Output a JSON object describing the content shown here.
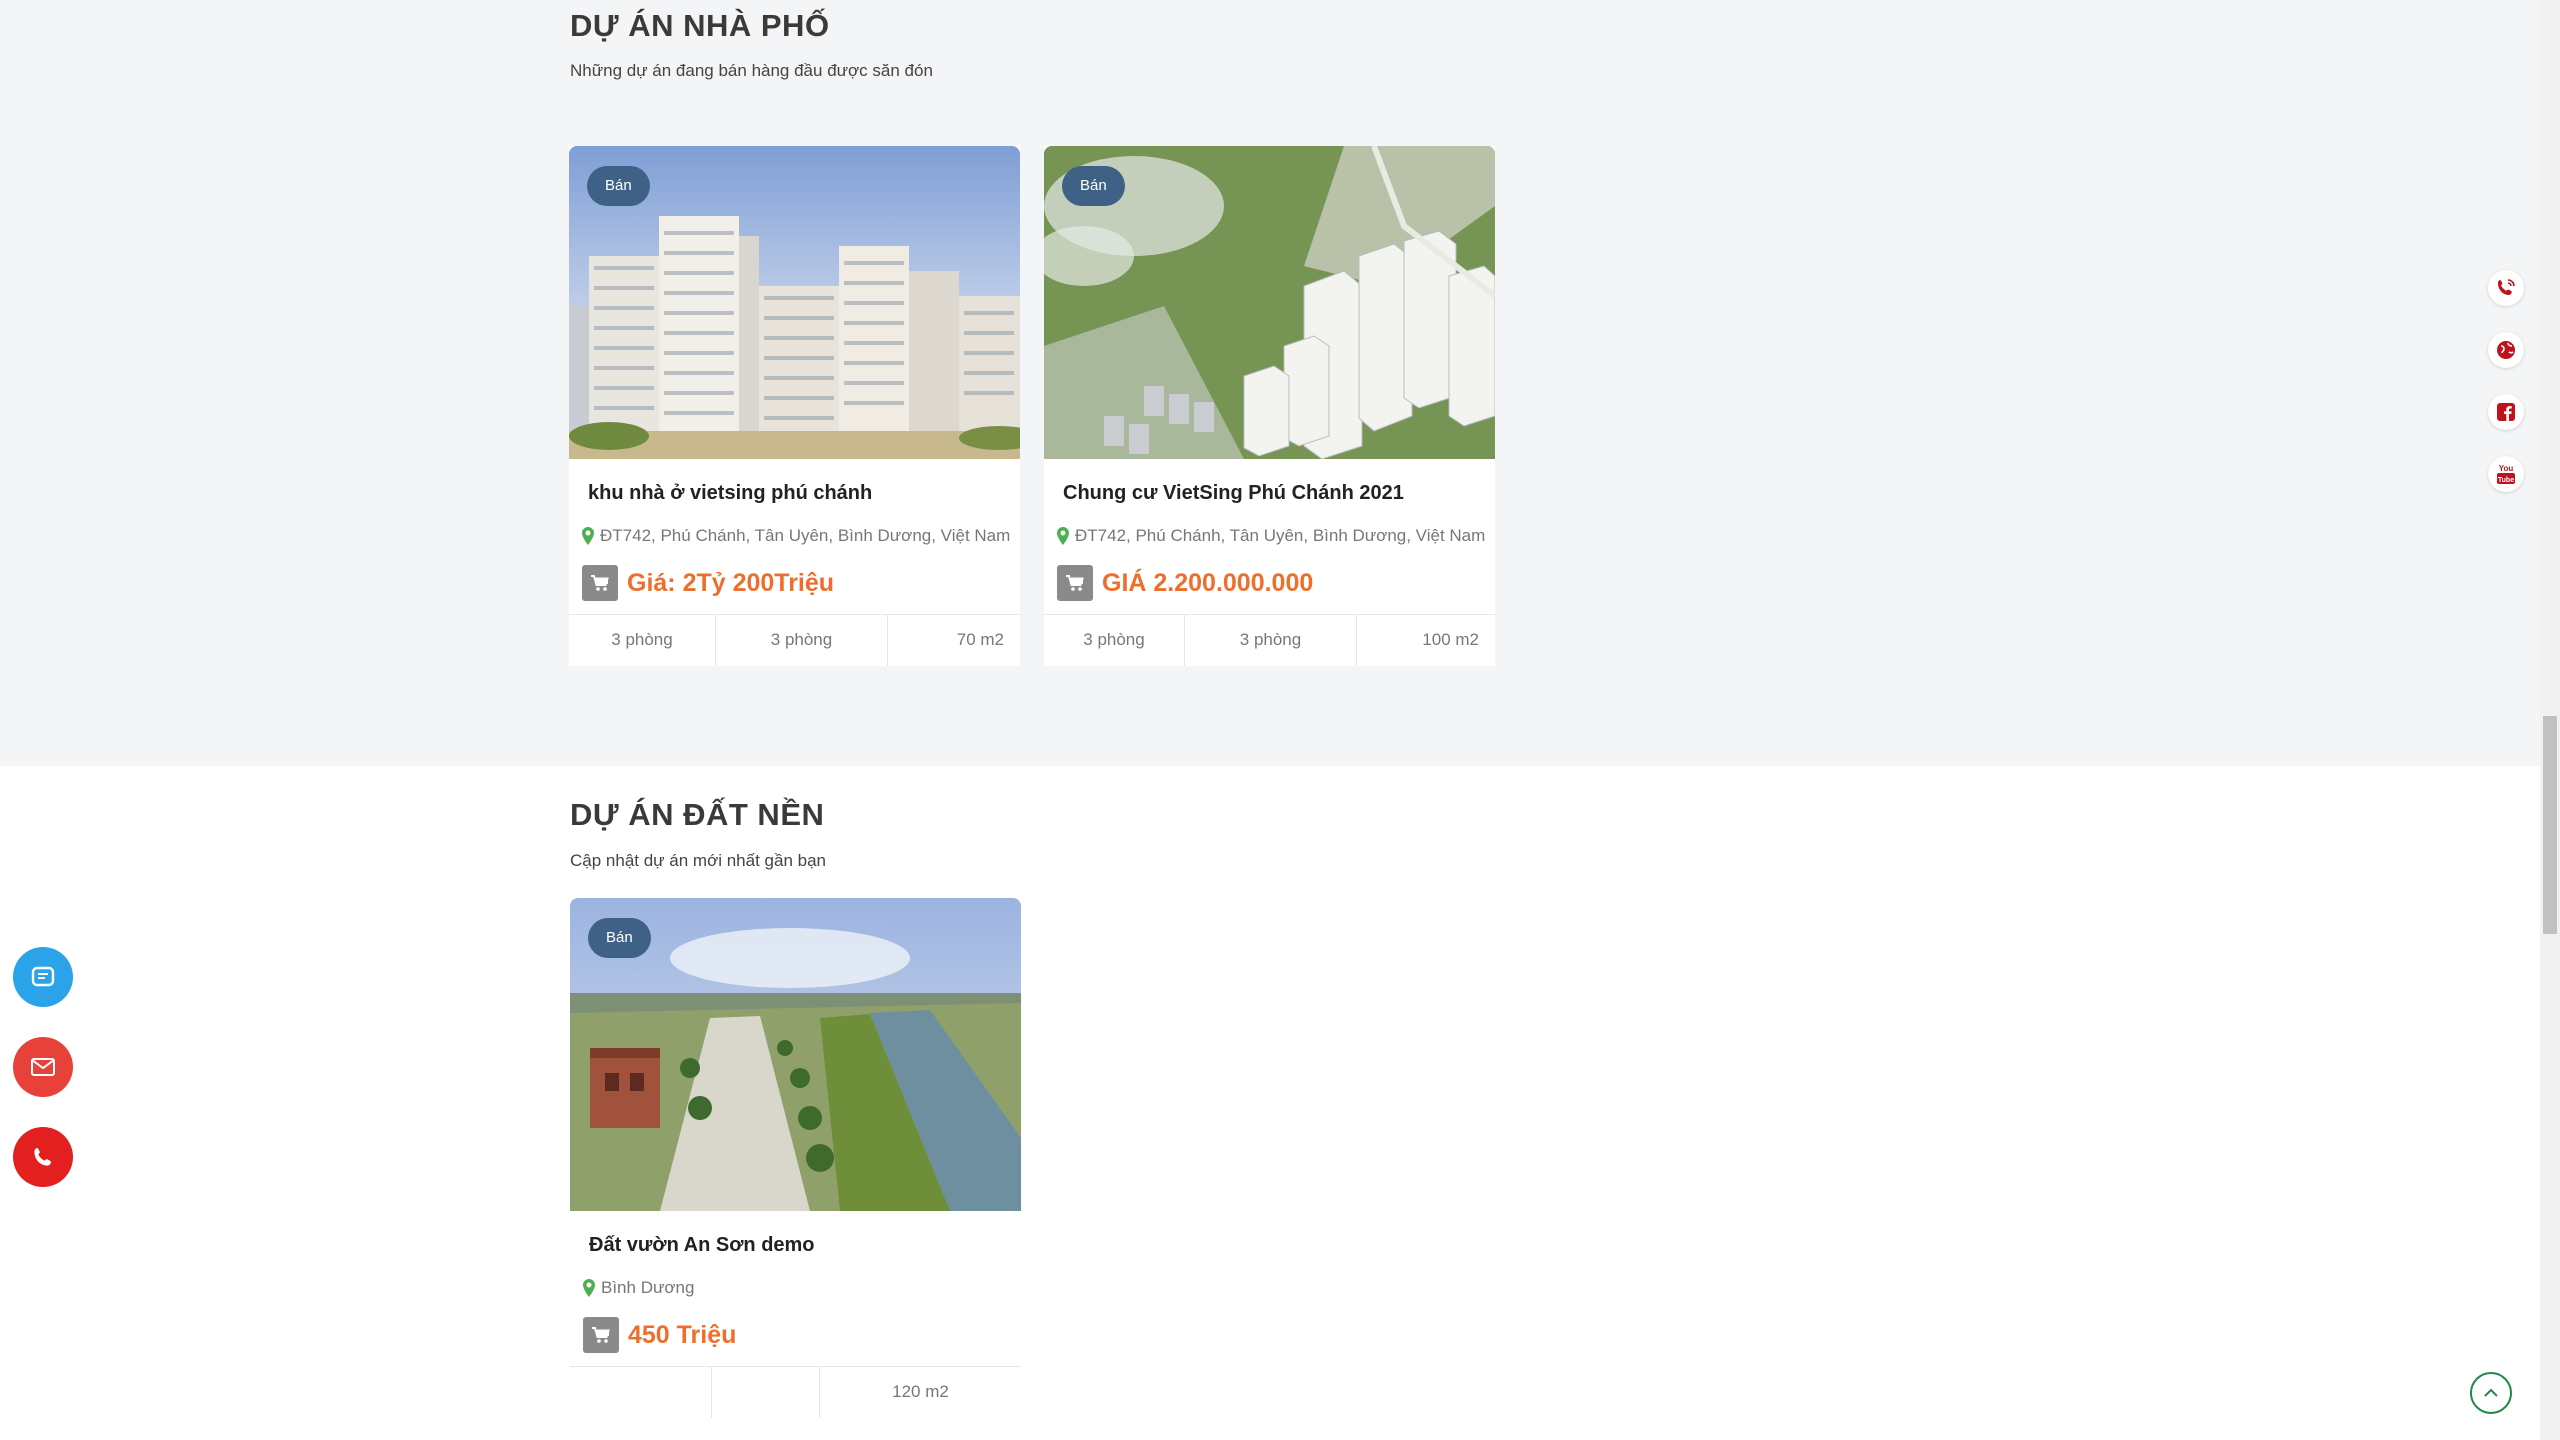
{
  "sections": {
    "nha_pho": {
      "title": "DỰ ÁN NHÀ PHỐ",
      "subtitle": "Những dự án đang bán hàng đầu được săn đón"
    },
    "dat_nen": {
      "title": "DỰ ÁN ĐẤT NỀN",
      "subtitle": "Cập nhật dự án mới nhất gần bạn"
    }
  },
  "cards": [
    {
      "badge": "Bán",
      "name": "khu nhà ở vietsing phú chánh",
      "address": "ĐT742, Phú Chánh, Tân Uyên, Bình Dương, Việt Nam",
      "price": "Giá: 2Tỷ 200Triệu",
      "specs": [
        "3 phòng",
        "3 phòng",
        "70 m2"
      ]
    },
    {
      "badge": "Bán",
      "name": "Chung cư VietSing Phú Chánh 2021",
      "address": "ĐT742, Phú Chánh, Tân Uyên, Bình Dương, Việt Nam",
      "price": "GIÁ 2.200.000.000",
      "specs": [
        "3 phòng",
        "3 phòng",
        "100 m2"
      ]
    },
    {
      "badge": "Bán",
      "name": "Đất vườn An Sơn demo",
      "address": "Bình Dương",
      "price": "450 Triệu",
      "specs": [
        "",
        "",
        "120 m2"
      ]
    }
  ],
  "right_social": [
    "phone-icon",
    "globe-icon",
    "facebook-icon",
    "youtube-icon"
  ],
  "left_float": [
    {
      "icon": "messenger-icon",
      "color": "#2aa3e8"
    },
    {
      "icon": "mail-icon",
      "color": "#e8413a"
    },
    {
      "icon": "call-icon",
      "color": "#e41f1f"
    }
  ],
  "colors": {
    "price": "#ee6f2d",
    "badge": "#3f6186",
    "pin": "#4caf50",
    "accent_red": "#c0121c"
  }
}
